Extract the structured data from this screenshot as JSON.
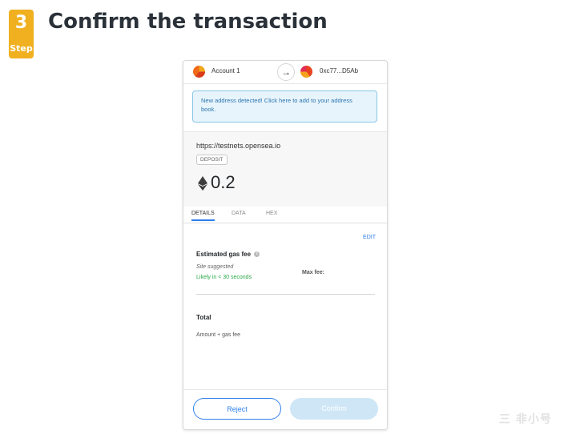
{
  "step": {
    "number": "3",
    "word": "Step",
    "color": "#f0b020"
  },
  "headline": "Confirm the transaction",
  "wallet": {
    "from_account": "Account 1",
    "to_address": "0xc77...D5Ab",
    "arrow_icon": "arrow-right-icon",
    "notice": "New address detected! Click here to add to your address book.",
    "origin": "https://testnets.opensea.io",
    "method_chip": "DEPOSIT",
    "amount": "0.2",
    "currency_icon": "eth-diamond-icon",
    "tabs": [
      {
        "label": "DETAILS",
        "active": true
      },
      {
        "label": "DATA",
        "active": false
      },
      {
        "label": "HEX",
        "active": false
      }
    ],
    "edit_label": "EDIT",
    "gas": {
      "title": "Estimated gas fee",
      "site_suggested": "Site suggested",
      "likely": "Likely in < 30 seconds",
      "max_fee": "Max fee:"
    },
    "total": {
      "title": "Total",
      "subtitle": "Amount + gas fee"
    },
    "buttons": {
      "reject": "Reject",
      "confirm": "Confirm"
    },
    "colors": {
      "accent": "#2f80ed",
      "success": "#28a745",
      "notice_bg": "#e8f4fb"
    }
  },
  "watermark": "三 非小号"
}
